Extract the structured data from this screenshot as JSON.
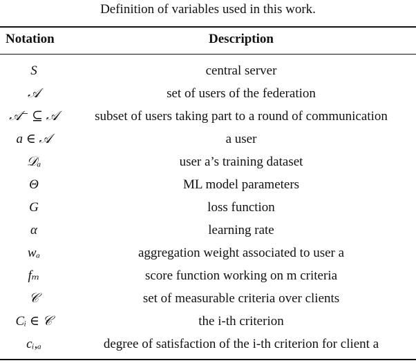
{
  "caption": "Definition of variables used in this work.",
  "header": {
    "notation": "Notation",
    "description": "Description"
  },
  "rows": [
    {
      "notation": "S",
      "description": "central server"
    },
    {
      "notation": "𝒜",
      "description": "set of users of the federation"
    },
    {
      "notation": "𝒜⁻ ⊆ 𝒜",
      "description": "subset of users taking part to a round of communication"
    },
    {
      "notation": "a ∈ 𝒜",
      "description": "a user"
    },
    {
      "notation": "𝒟ₐ",
      "description": "user a’s training dataset"
    },
    {
      "notation": "Θ",
      "description": "ML model parameters"
    },
    {
      "notation": "G",
      "description": "loss function"
    },
    {
      "notation": "α",
      "description": "learning rate"
    },
    {
      "notation": "wₐ",
      "description": "aggregation weight associated to user a"
    },
    {
      "notation": "fₘ",
      "description": "score function working on m criteria"
    },
    {
      "notation": "𝒞",
      "description": "set of measurable criteria over clients"
    },
    {
      "notation": "Cᵢ ∈ 𝒞",
      "description": "the i-th criterion"
    },
    {
      "notation": "cᵢ,ₐ",
      "description": "degree of satisfaction of the i-th criterion for client a"
    }
  ]
}
